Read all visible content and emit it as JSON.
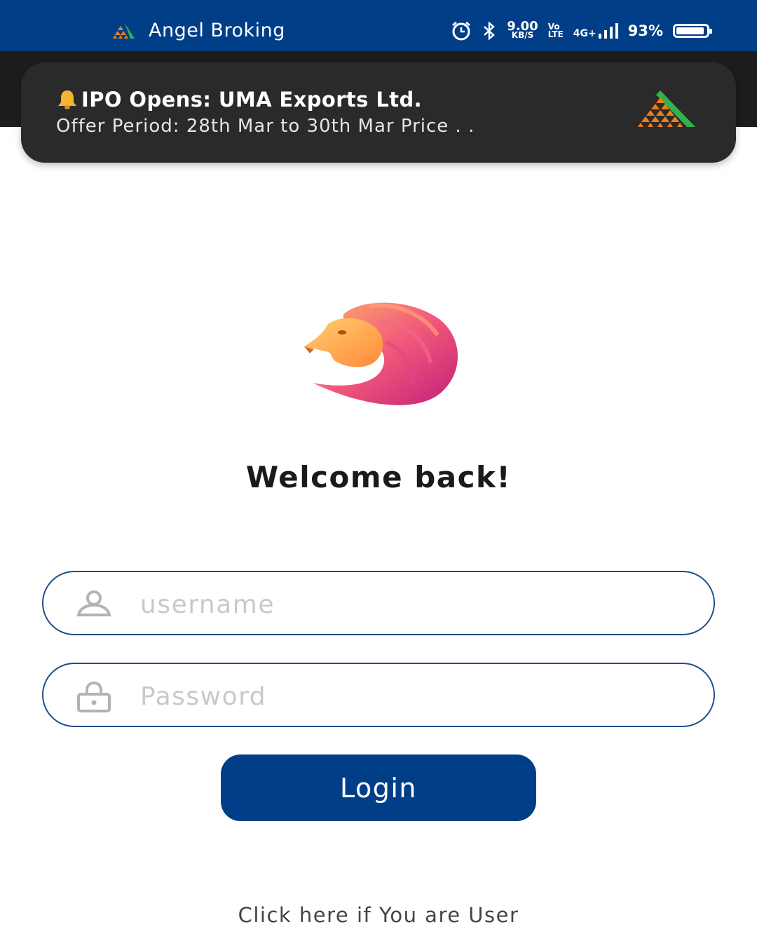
{
  "status_bar": {
    "app_name": "Angel Broking",
    "speed_value": "9.00",
    "speed_unit": "KB/S",
    "volte_top": "Vo",
    "volte_bottom": "LTE",
    "network": "4G+",
    "battery_percent": "93%",
    "battery_level": 0.93,
    "background_color": "#003f87"
  },
  "notification": {
    "title": "IPO Opens: UMA Exports Ltd.",
    "body": "Offer Period: 28th Mar to 30th Mar  Price . .",
    "icons": [
      "bell-icon",
      "angel-broking-logo"
    ]
  },
  "login": {
    "heading": "Welcome back!",
    "username_placeholder": "username",
    "password_placeholder": "Password",
    "login_label": "Login",
    "user_link": "Click here if You are User",
    "icons": [
      "user-icon",
      "lock-icon",
      "lion-logo"
    ],
    "accent_color": "#003f87"
  }
}
